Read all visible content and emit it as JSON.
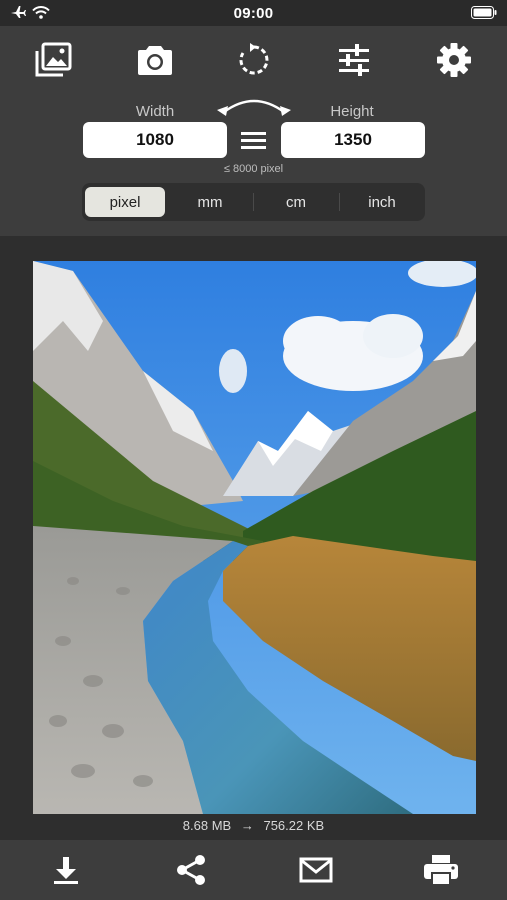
{
  "status": {
    "time": "09:00",
    "icons": [
      "airplane-icon",
      "wifi-icon",
      "battery-icon"
    ]
  },
  "toolbar": {
    "icons": [
      "photo-library-icon",
      "camera-icon",
      "rotate-icon",
      "adjustments-icon",
      "settings-icon"
    ]
  },
  "dimensions": {
    "width_label": "Width",
    "height_label": "Height",
    "width_value": "1080",
    "height_value": "1350",
    "limit_note": "≤ 8000 pixel"
  },
  "units": {
    "options": [
      "pixel",
      "mm",
      "cm",
      "inch"
    ],
    "selected": "pixel"
  },
  "image_info": {
    "original_size": "8.68 MB",
    "arrow": "→",
    "new_size": "756.22 KB"
  },
  "bottom_bar": {
    "icons": [
      "download-icon",
      "share-icon",
      "mail-icon",
      "print-icon"
    ]
  },
  "colors": {
    "accent": "#ffffff",
    "panel": "#3d3d3d",
    "background": "#2e2e2e",
    "selected_segment": "#e5e5df"
  }
}
